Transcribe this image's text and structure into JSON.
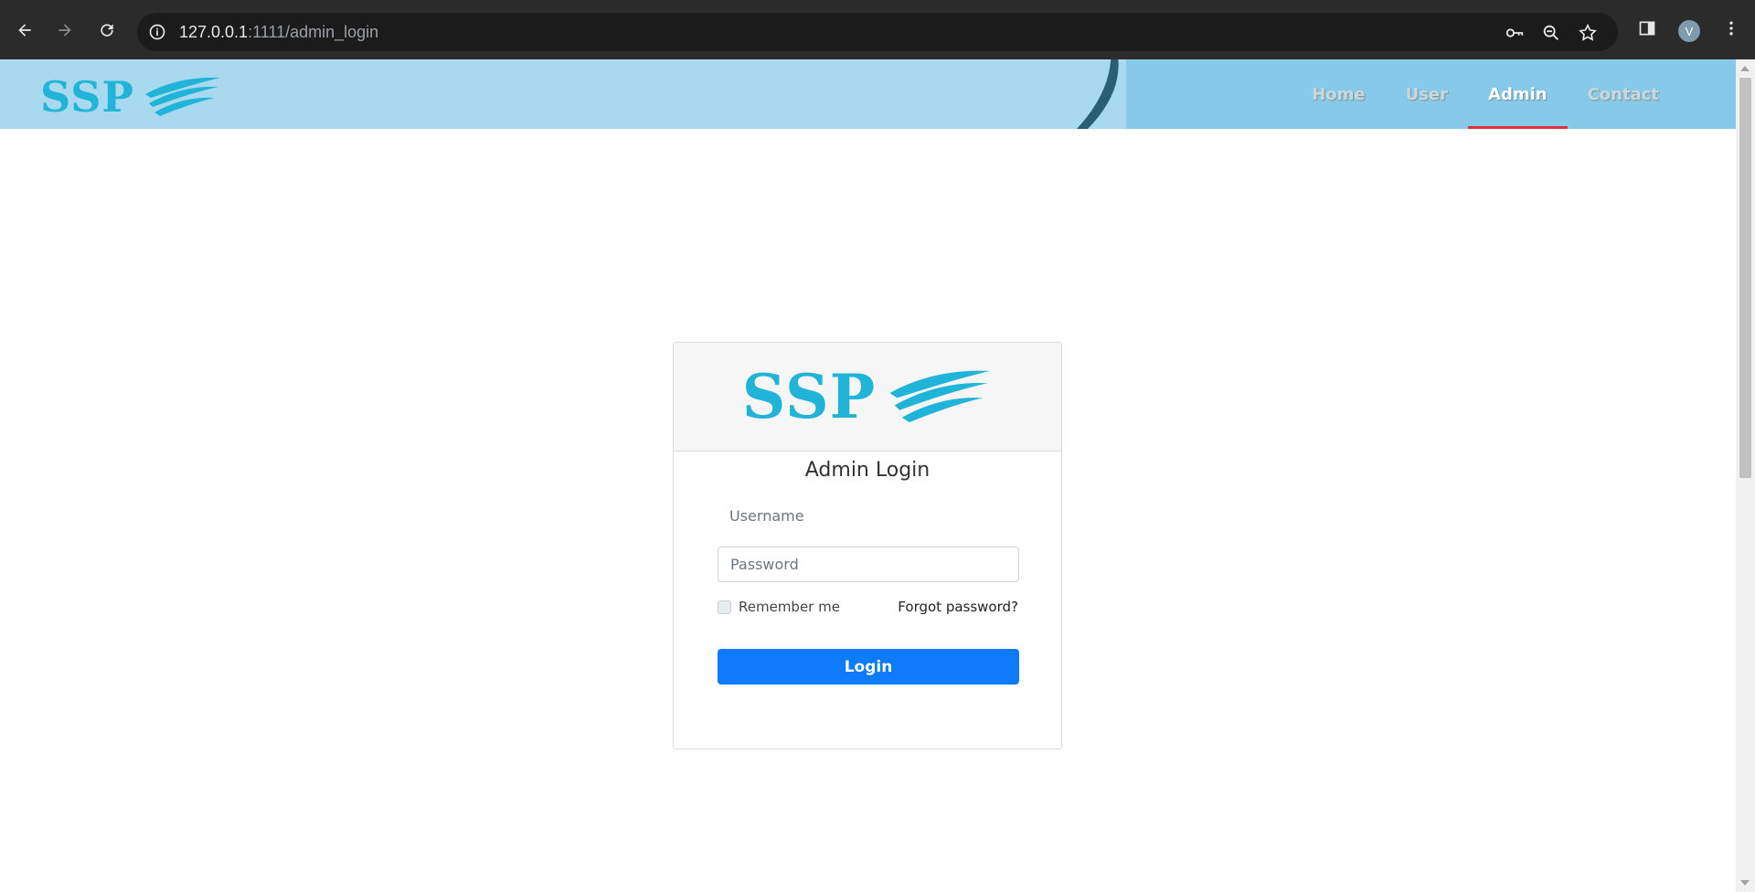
{
  "browser": {
    "url_host": "127.0.0.1",
    "url_rest": ":1111/admin_login",
    "profile_initial": "V"
  },
  "header": {
    "logo_text": "SSP",
    "nav": [
      {
        "label": "Home",
        "active": false
      },
      {
        "label": "User",
        "active": false
      },
      {
        "label": "Admin",
        "active": true
      },
      {
        "label": "Contact",
        "active": false
      }
    ]
  },
  "login": {
    "logo_text": "SSP",
    "title": "Admin Login",
    "username_placeholder": "Username",
    "password_placeholder": "Password",
    "remember_label": "Remember me",
    "forgot_label": "Forgot password?",
    "button_label": "Login"
  },
  "colors": {
    "brand": "#1fb4d8",
    "header_light": "#a9d9ee",
    "header_dark": "#86c9e8",
    "primary": "#0d7bfa",
    "active_underline": "#e0303b"
  }
}
